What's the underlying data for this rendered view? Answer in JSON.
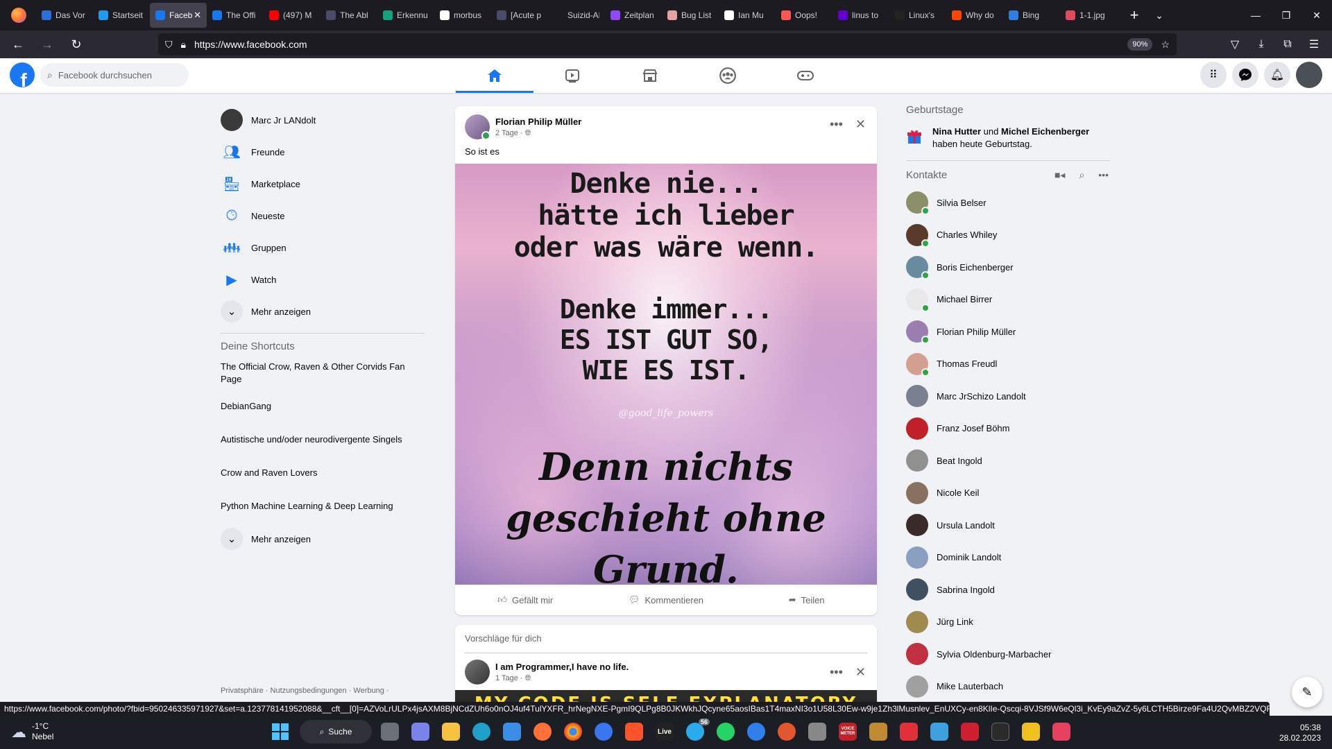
{
  "browser": {
    "tabs": [
      {
        "label": "Das Vor",
        "color": "#2a6fdb"
      },
      {
        "label": "Startseit",
        "color": "#1d9bf0"
      },
      {
        "label": "Faceb",
        "color": "#1877f2",
        "active": true
      },
      {
        "label": "The Offi",
        "color": "#1877f2"
      },
      {
        "label": "(497) M",
        "color": "#ff0000"
      },
      {
        "label": "The Abl",
        "color": "#4a4a6a"
      },
      {
        "label": "Erkennu",
        "color": "#10a37f"
      },
      {
        "label": "morbus",
        "color": "#ffffff"
      },
      {
        "label": "[Acute p",
        "color": "#4a4a6a"
      },
      {
        "label": "Suizid-APP",
        "color": "#1c1b22"
      },
      {
        "label": "Zeitplan",
        "color": "#9147ff"
      },
      {
        "label": "Bug List",
        "color": "#e8a0a0"
      },
      {
        "label": "Ian Mu",
        "color": "#ffffff"
      },
      {
        "label": "Oops!",
        "color": "#ff5555"
      },
      {
        "label": "linus to",
        "color": "#6001d2"
      },
      {
        "label": "Linux's",
        "color": "#222222"
      },
      {
        "label": "Why do",
        "color": "#ff4500"
      },
      {
        "label": "Bing",
        "color": "#2f7de1"
      },
      {
        "label": "1-1.jpg",
        "color": "#e04a5a"
      }
    ],
    "url": "https://www.facebook.com",
    "zoom": "90%",
    "status_url": "https://www.facebook.com/photo/?fbid=950246335971927&set=a.123778141952088&__cft__[0]=AZVoLrULPx4jsAXM8BjNCdZUh6o0nOJ4uf4TulYXFR_hrNegNXE-PgmI9QLPg8B0JKWkhJQcyne65aosIBas1T4maxNI3o1U58L30Ew-w9je1Zh3lMusnlev_EnUXCy-en8KlIe-Qscqi-8VJSf9W6eQl3i_KvEy9aZvZ-5y6LCTH5Birze9Fa4U2QvMBZ2VQFc&__tn__=EH-R"
  },
  "fb": {
    "search_placeholder": "Facebook durchsuchen",
    "logo": "f"
  },
  "left": {
    "profile_name": "Marc Jr LANdolt",
    "menu": [
      {
        "label": "Freunde",
        "icon": "friends-icon"
      },
      {
        "label": "Marketplace",
        "icon": "marketplace-icon"
      },
      {
        "label": "Neueste",
        "icon": "recent-icon"
      },
      {
        "label": "Gruppen",
        "icon": "groups-icon"
      },
      {
        "label": "Watch",
        "icon": "watch-icon"
      }
    ],
    "more_label": "Mehr anzeigen",
    "shortcuts_title": "Deine Shortcuts",
    "shortcuts": [
      {
        "label": "The Official Crow, Raven & Other Corvids Fan Page",
        "color": "#6b5a50"
      },
      {
        "label": "DebianGang",
        "color": "#a0141e"
      },
      {
        "label": "Autistische und/oder neurodivergente Singels",
        "color": "#1a1a1a"
      },
      {
        "label": "Crow and Raven Lovers",
        "color": "#4a5a3a"
      },
      {
        "label": "Python Machine Learning & Deep Learning",
        "color": "#2a2a2a"
      }
    ],
    "more_label2": "Mehr anzeigen",
    "footer": "Privatsphäre · Nutzungsbedingungen · Werbung ·"
  },
  "post": {
    "author": "Florian Philip Müller",
    "time": "2 Tage",
    "text": "So ist es",
    "image_lines1": [
      "Denke nie...",
      "hätte ich lieber",
      "oder was wäre wenn."
    ],
    "image_lines2": [
      "Denke immer...",
      "ES IST GUT SO,",
      "WIE ES IST."
    ],
    "watermark": "@good_life_powers",
    "image_lines3": [
      "Denn nichts",
      "geschieht ohne",
      "Grund."
    ],
    "like": "Gefällt mir",
    "comment": "Kommentieren",
    "share": "Teilen"
  },
  "suggestions": {
    "title": "Vorschläge für dich",
    "author": "I am Programmer,I have no life.",
    "time": "1 Tage",
    "image_text": "MY CODE IS SELF EXPLANATORY"
  },
  "right": {
    "birthdays_title": "Geburtstage",
    "bday_name1": "Nina Hutter",
    "bday_and": " und ",
    "bday_name2": "Michel Eichenberger",
    "bday_rest": "haben heute Geburtstag.",
    "contacts_title": "Kontakte",
    "contacts": [
      {
        "name": "Silvia Belser",
        "online": true,
        "color": "#8a8f6a"
      },
      {
        "name": "Charles Whiley",
        "online": true,
        "color": "#5a3a2a"
      },
      {
        "name": "Boris Eichenberger",
        "online": true,
        "color": "#6a8aa0"
      },
      {
        "name": "Michael Birrer",
        "online": true,
        "color": "#e8e8e8"
      },
      {
        "name": "Florian Philip Müller",
        "online": true,
        "color": "#9a7fb0"
      },
      {
        "name": "Thomas Freudl",
        "online": true,
        "color": "#d4a090"
      },
      {
        "name": "Marc JrSchizo Landolt",
        "online": false,
        "color": "#7a8090"
      },
      {
        "name": "Franz Josef Böhm",
        "online": false,
        "color": "#c0202a"
      },
      {
        "name": "Beat Ingold",
        "online": false,
        "color": "#909090"
      },
      {
        "name": "Nicole Keil",
        "online": false,
        "color": "#8a7060"
      },
      {
        "name": "Ursula Landolt",
        "online": false,
        "color": "#3a2a2a"
      },
      {
        "name": "Dominik Landolt",
        "online": false,
        "color": "#8aa0c0"
      },
      {
        "name": "Sabrina Ingold",
        "online": false,
        "color": "#405060"
      },
      {
        "name": "Jürg Link",
        "online": false,
        "color": "#a08a50"
      },
      {
        "name": "Sylvia Oldenburg-Marbacher",
        "online": false,
        "color": "#c03040"
      },
      {
        "name": "Mike Lauterbach",
        "online": false,
        "color": "#a0a0a0"
      }
    ]
  },
  "taskbar": {
    "temp": "-1°C",
    "weather": "Nebel",
    "search": "Suche",
    "time": "05:38",
    "date": "28.02.2023",
    "telegram_badge": "56",
    "live_label": "Live",
    "voicemeeter_label": "VOICE METER"
  }
}
